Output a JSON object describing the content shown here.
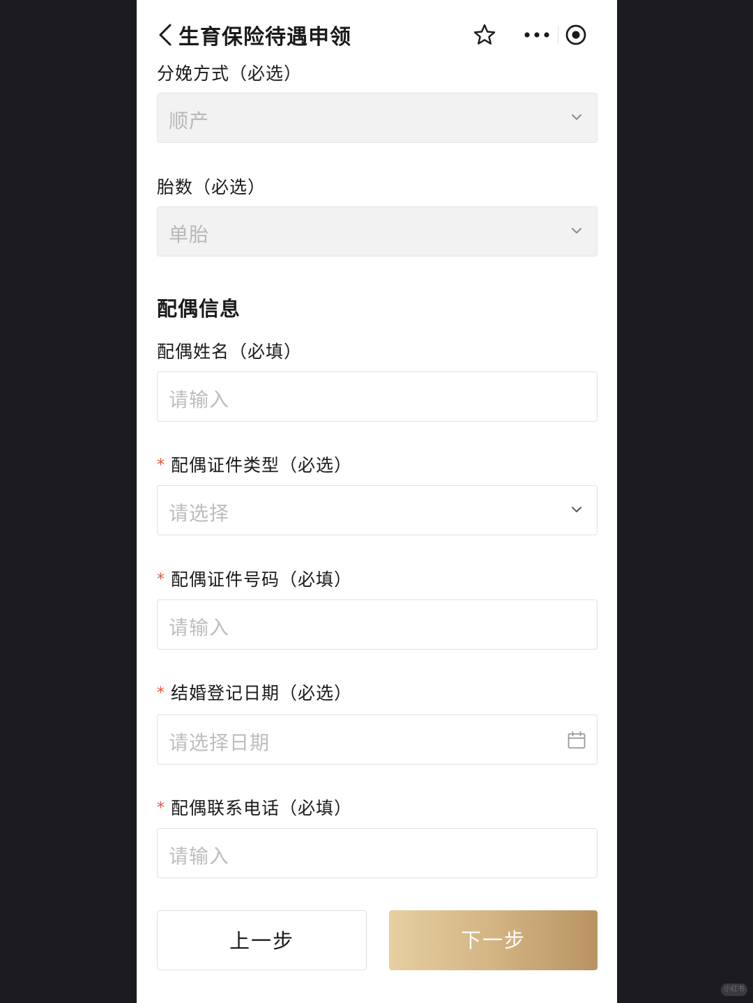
{
  "navbar": {
    "title": "生育保险待遇申领",
    "back_icon": "chevron-left-icon",
    "favorite_icon": "star-icon",
    "more_icon": "more-dots-icon",
    "close_icon": "target-circle-icon"
  },
  "form": {
    "delivery_method": {
      "label": "分娩方式（必选）",
      "value": "顺产",
      "disabled": true
    },
    "fetus_count": {
      "label": "胎数（必选）",
      "value": "单胎",
      "disabled": true
    },
    "spouse_section_title": "配偶信息",
    "spouse_name": {
      "label": "配偶姓名（必填）",
      "placeholder": "请输入"
    },
    "spouse_id_type": {
      "required_mark": "*",
      "label": "配偶证件类型（必选）",
      "placeholder": "请选择"
    },
    "spouse_id_number": {
      "required_mark": "*",
      "label": "配偶证件号码（必填）",
      "placeholder": "请输入"
    },
    "marriage_date": {
      "required_mark": "*",
      "label": "结婚登记日期（必选）",
      "placeholder": "请选择日期"
    },
    "spouse_phone": {
      "required_mark": "*",
      "label": "配偶联系电话（必填）",
      "placeholder": "请输入"
    }
  },
  "actions": {
    "prev_label": "上一步",
    "next_label": "下一步"
  },
  "watermark_text": "小红书",
  "colors": {
    "required": "#e8523a",
    "next_button_gradient_start": "#e6cfa0",
    "next_button_gradient_end": "#b99362",
    "outer_background": "#1b1b20"
  }
}
